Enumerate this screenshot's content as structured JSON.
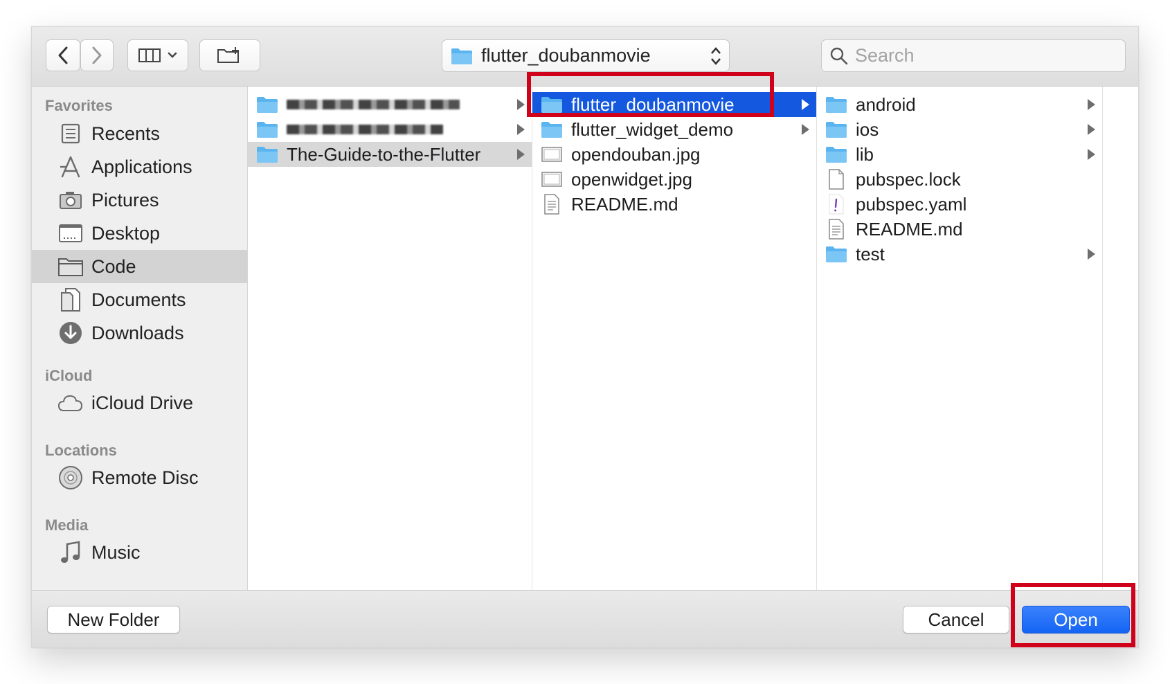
{
  "toolbar": {
    "back_icon": "chevron-left-icon",
    "forward_icon": "chevron-right-icon",
    "view_icon": "columns-view-icon",
    "new_folder_icon": "new-folder-icon",
    "path_popup_label": "flutter_doubanmovie",
    "search_placeholder": "Search",
    "search_value": ""
  },
  "sidebar": {
    "sections": [
      {
        "header": "Favorites",
        "items": [
          {
            "label": "Recents",
            "icon": "recents-icon"
          },
          {
            "label": "Applications",
            "icon": "applications-icon"
          },
          {
            "label": "Pictures",
            "icon": "camera-icon"
          },
          {
            "label": "Desktop",
            "icon": "desktop-icon"
          },
          {
            "label": "Code",
            "icon": "folder-icon",
            "selected": true
          },
          {
            "label": "Documents",
            "icon": "documents-icon"
          },
          {
            "label": "Downloads",
            "icon": "download-icon"
          }
        ]
      },
      {
        "header": "iCloud",
        "items": [
          {
            "label": "iCloud Drive",
            "icon": "cloud-icon"
          }
        ]
      },
      {
        "header": "Locations",
        "items": [
          {
            "label": "Remote Disc",
            "icon": "disc-icon"
          }
        ]
      },
      {
        "header": "Media",
        "items": [
          {
            "label": "Music",
            "icon": "music-icon"
          }
        ]
      }
    ]
  },
  "columns": [
    {
      "rows": [
        {
          "name": "",
          "type": "folder",
          "blurred": true,
          "has_children": true
        },
        {
          "name": "",
          "type": "folder",
          "blurred": true,
          "has_children": true
        },
        {
          "name": "The-Guide-to-the-Flutter",
          "type": "folder",
          "has_children": true,
          "state": "parent-selected"
        }
      ]
    },
    {
      "rows": [
        {
          "name": "flutter_doubanmovie",
          "type": "folder",
          "has_children": true,
          "state": "selected"
        },
        {
          "name": "flutter_widget_demo",
          "type": "folder",
          "has_children": true
        },
        {
          "name": "opendouban.jpg",
          "type": "image"
        },
        {
          "name": "openwidget.jpg",
          "type": "image"
        },
        {
          "name": "README.md",
          "type": "text"
        }
      ]
    },
    {
      "rows": [
        {
          "name": "android",
          "type": "folder",
          "has_children": true
        },
        {
          "name": "ios",
          "type": "folder",
          "has_children": true
        },
        {
          "name": "lib",
          "type": "folder",
          "has_children": true
        },
        {
          "name": "pubspec.lock",
          "type": "blank"
        },
        {
          "name": "pubspec.yaml",
          "type": "yaml"
        },
        {
          "name": "README.md",
          "type": "text"
        },
        {
          "name": "test",
          "type": "folder",
          "has_children": true
        }
      ]
    }
  ],
  "bottom": {
    "new_folder_label": "New Folder",
    "cancel_label": "Cancel",
    "open_label": "Open"
  },
  "colors": {
    "selection_blue": "#1458e0",
    "folder_blue": "#5ab4f0",
    "annotation_red": "#d0021b"
  }
}
